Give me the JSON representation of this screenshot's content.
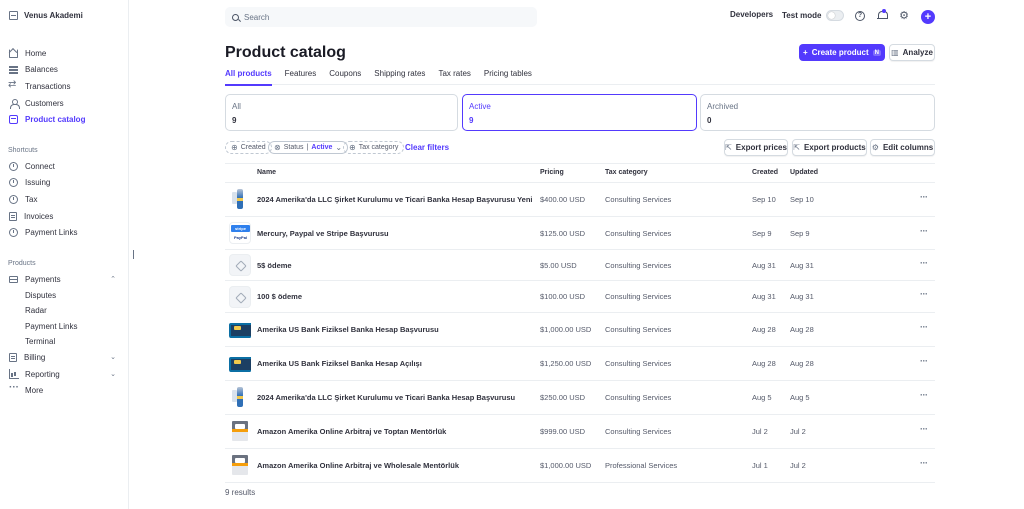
{
  "brand": {
    "name": "Venus Akademi"
  },
  "sidebar": {
    "main": [
      {
        "label": "Home",
        "icon": "home-icon"
      },
      {
        "label": "Balances",
        "icon": "balances-icon"
      },
      {
        "label": "Transactions",
        "icon": "transactions-icon"
      },
      {
        "label": "Customers",
        "icon": "customers-icon"
      },
      {
        "label": "Product catalog",
        "icon": "product-catalog-icon",
        "active": true
      }
    ],
    "shortcuts_label": "Shortcuts",
    "shortcuts": [
      {
        "label": "Connect",
        "icon": "connect-icon"
      },
      {
        "label": "Issuing",
        "icon": "issuing-icon"
      },
      {
        "label": "Tax",
        "icon": "tax-icon"
      },
      {
        "label": "Invoices",
        "icon": "invoices-icon"
      },
      {
        "label": "Payment Links",
        "icon": "payment-links-icon"
      }
    ],
    "products_label": "Products",
    "payments": {
      "label": "Payments",
      "icon": "payments-icon",
      "children": [
        "Disputes",
        "Radar",
        "Payment Links",
        "Terminal"
      ]
    },
    "billing": {
      "label": "Billing",
      "icon": "billing-icon"
    },
    "reporting": {
      "label": "Reporting",
      "icon": "reporting-icon"
    },
    "more": {
      "label": "More",
      "icon": "more-icon"
    }
  },
  "topbar": {
    "search_placeholder": "Search",
    "developers": "Developers",
    "test_mode": "Test mode"
  },
  "header": {
    "title": "Product catalog",
    "create_product": "Create product",
    "create_shortcut": "N",
    "analyze": "Analyze"
  },
  "tabs": [
    "All products",
    "Features",
    "Coupons",
    "Shipping rates",
    "Tax rates",
    "Pricing tables"
  ],
  "filter_cards": [
    {
      "label": "All",
      "value": "9"
    },
    {
      "label": "Active",
      "value": "9",
      "active": true
    },
    {
      "label": "Archived",
      "value": "0"
    }
  ],
  "filters": {
    "created": "Created",
    "status": "Status",
    "status_value": "Active",
    "tax_category": "Tax category",
    "clear": "Clear filters",
    "export_prices": "Export prices",
    "export_products": "Export products",
    "edit_columns": "Edit columns"
  },
  "table": {
    "columns": [
      "Name",
      "Pricing",
      "Tax category",
      "Created",
      "Updated"
    ],
    "rows": [
      {
        "thumb": "bottle",
        "name": "2024 Amerika'da LLC Şirket Kurulumu ve Ticari Banka Hesap Başvurusu Yeni",
        "pricing": "$400.00 USD",
        "tax": "Consulting Services",
        "created": "Sep 10",
        "updated": "Sep 10"
      },
      {
        "thumb": "stripe",
        "name": "Mercury, Paypal ve Stripe Başvurusu",
        "pricing": "$125.00 USD",
        "tax": "Consulting Services",
        "created": "Sep 9",
        "updated": "Sep 9"
      },
      {
        "thumb": "placeholder",
        "name": "5$ ödeme",
        "pricing": "$5.00 USD",
        "tax": "Consulting Services",
        "created": "Aug 31",
        "updated": "Aug 31"
      },
      {
        "thumb": "placeholder",
        "name": "100 $ ödeme",
        "pricing": "$100.00 USD",
        "tax": "Consulting Services",
        "created": "Aug 31",
        "updated": "Aug 31"
      },
      {
        "thumb": "bank",
        "name": "Amerika US Bank Fiziksel Banka Hesap Başvurusu",
        "pricing": "$1,000.00 USD",
        "tax": "Consulting Services",
        "created": "Aug 28",
        "updated": "Aug 28"
      },
      {
        "thumb": "bank",
        "name": "Amerika US Bank Fiziksel Banka Hesap Açılışı",
        "pricing": "$1,250.00 USD",
        "tax": "Consulting Services",
        "created": "Aug 28",
        "updated": "Aug 28"
      },
      {
        "thumb": "bottle",
        "name": "2024 Amerika'da LLC Şirket Kurulumu ve Ticari Banka Hesap Başvurusu",
        "pricing": "$250.00 USD",
        "tax": "Consulting Services",
        "created": "Aug 5",
        "updated": "Aug 5"
      },
      {
        "thumb": "amazon",
        "name": "Amazon Amerika Online Arbitraj ve Toptan Mentörlük",
        "pricing": "$999.00 USD",
        "tax": "Consulting Services",
        "created": "Jul 2",
        "updated": "Jul 2"
      },
      {
        "thumb": "amazon",
        "name": "Amazon Amerika Online Arbitraj ve Wholesale Mentörlük",
        "pricing": "$1,000.00 USD",
        "tax": "Professional Services",
        "created": "Jul 1",
        "updated": "Jul 2"
      }
    ],
    "results": "9 results"
  },
  "colors": {
    "accent": "#533afd",
    "text": "#30313d",
    "muted": "#687385",
    "border": "#d5dbe1"
  }
}
